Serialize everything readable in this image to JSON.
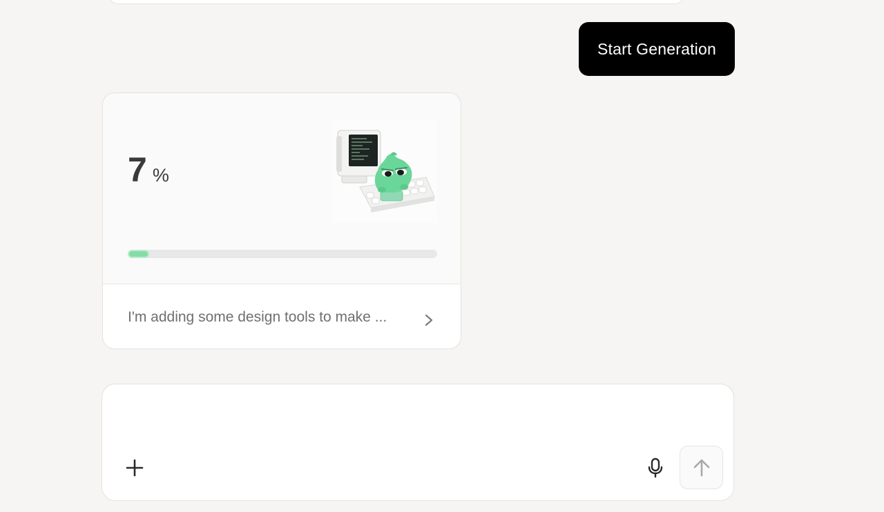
{
  "chat": {
    "start_button_label": "Start Generation"
  },
  "progress_card": {
    "percent": "7",
    "percent_sign": "%",
    "progress_fraction": 0.07,
    "status_text": "I'm adding some design tools to make ...",
    "accent_color": "#86dca8",
    "illustration": "retro-computer-green-mascot"
  },
  "composer": {
    "input_value": "",
    "add_icon": "plus-icon",
    "mic_icon": "microphone-icon",
    "send_icon": "arrow-up-icon"
  }
}
